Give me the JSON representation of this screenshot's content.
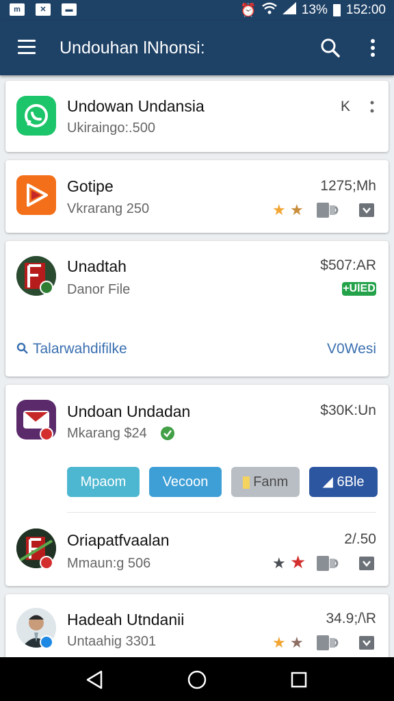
{
  "status_bar": {
    "battery": "13%",
    "time": "152:00",
    "left_icon_1": "m"
  },
  "app_bar": {
    "title": "Undouhan lNhonsi:"
  },
  "items": [
    {
      "title": "Undowan Undansia",
      "subtitle": "Ukiraingo:.500",
      "price": "K"
    },
    {
      "title": "Gotipe",
      "subtitle": "Vkrarang 250",
      "price": "1275;Mh"
    },
    {
      "title": "Unadtah",
      "subtitle": "Danor File",
      "price": "$507:AR",
      "badge": "+UlED",
      "link": "Talarwahdifilke",
      "link2": "V0Wesi"
    },
    {
      "title": "Undoan Undadan",
      "subtitle": "Mkarang $24",
      "price": "$30K:Un",
      "chips": [
        "Mpaom",
        "Vecoon",
        "Fanm",
        "6Ble"
      ]
    },
    {
      "title": "Oriapatfvaalan",
      "subtitle": "Mmaun:g 506",
      "price": "2/.50"
    },
    {
      "title": "Hadeah Utndanii",
      "subtitle": "Untaahig 3301",
      "price": "34.9;/\\R"
    }
  ],
  "colors": {
    "appbar": "#1e4166",
    "whatsapp": "#1cc46a",
    "play": "#f36f1a",
    "chip1": "#4db6d0",
    "chip2": "#3e9fd6",
    "chip3": "#b9bec4",
    "chip4": "#2c56a0",
    "badge": "#23a24a"
  }
}
